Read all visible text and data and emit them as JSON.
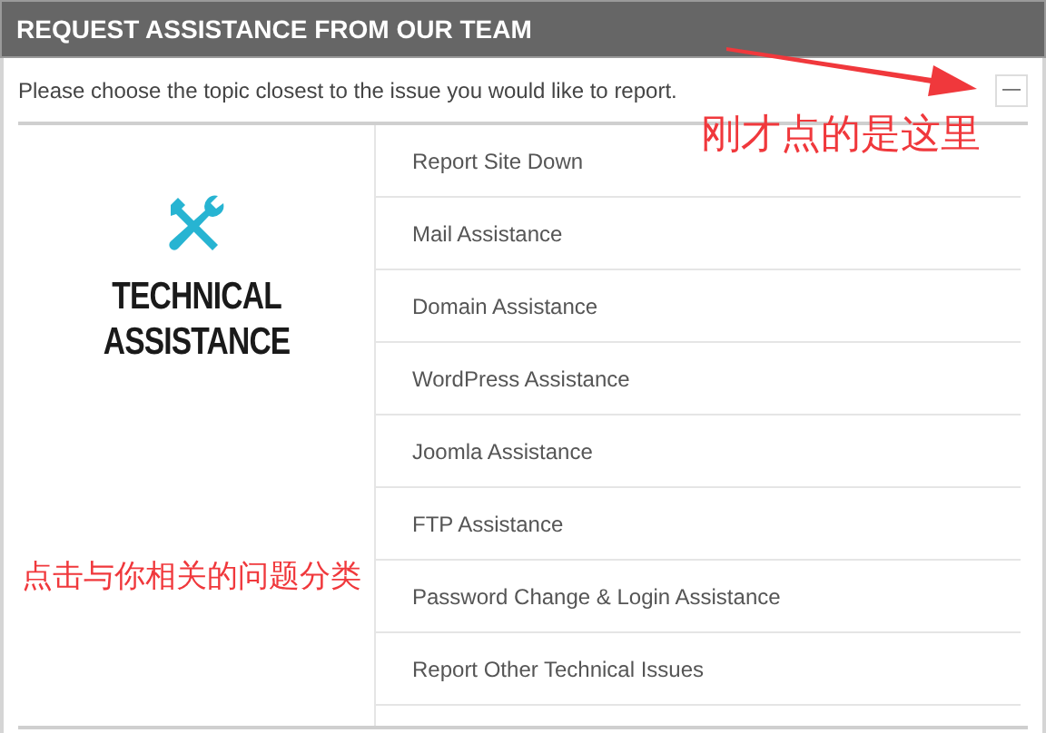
{
  "panel": {
    "title": "REQUEST ASSISTANCE FROM OUR TEAM",
    "intro": "Please choose the topic closest to the issue you would like to report.",
    "collapse_button": "—"
  },
  "category": {
    "title_lines": [
      "TECHNICAL",
      "ASSISTANCE"
    ]
  },
  "topics": [
    "Report Site Down",
    "Mail Assistance",
    "Domain Assistance",
    "WordPress Assistance",
    "Joomla Assistance",
    "FTP Assistance",
    "Password Change & Login Assistance",
    "Report Other Technical Issues"
  ],
  "annotations": [
    {
      "text": "刚才点的是这里"
    },
    {
      "text": "点击与你相关的问题分类"
    }
  ]
}
